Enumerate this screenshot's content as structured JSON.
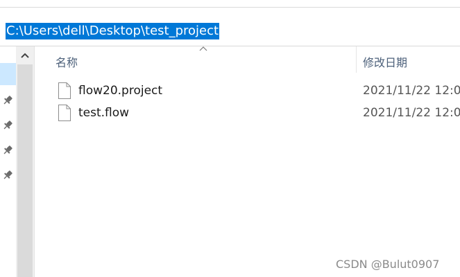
{
  "address_bar": {
    "path": "C:\\Users\\dell\\Desktop\\test_project"
  },
  "file_list": {
    "columns": {
      "name": "名称",
      "date_modified": "修改日期"
    },
    "rows": [
      {
        "name": "flow20.project",
        "date": "2021/11/22 12:0"
      },
      {
        "name": "test.flow",
        "date": "2021/11/22 12:0"
      }
    ]
  },
  "watermark": "CSDN @Bulut0907",
  "icons": {
    "pin": "pin-icon",
    "file": "file-icon",
    "scroll_up": "chevron-up-icon",
    "sort": "sort-arrow-icon"
  },
  "colors": {
    "selection": "#0078d7",
    "nav_selected": "#cce8ff"
  }
}
